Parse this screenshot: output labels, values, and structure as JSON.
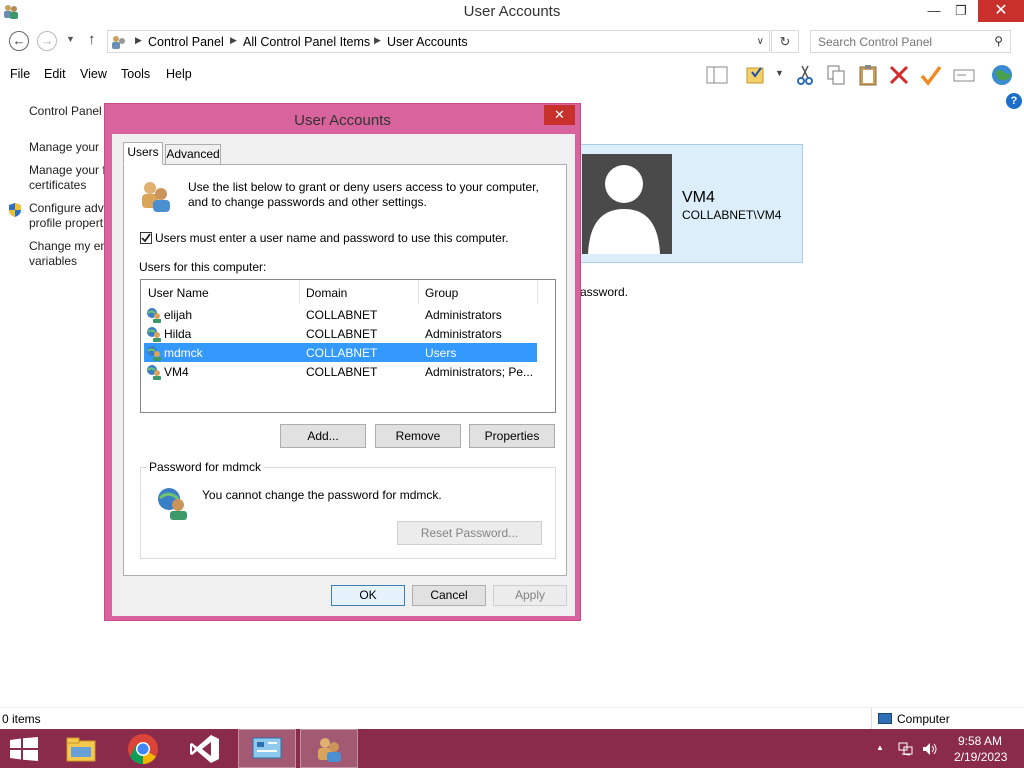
{
  "window": {
    "title": "User Accounts",
    "controls": {
      "minimize": "—",
      "maximize": "❐",
      "close": "✕"
    }
  },
  "address": {
    "crumbs": [
      "Control Panel",
      "All Control Panel Items",
      "User Accounts"
    ],
    "search_placeholder": "Search Control Panel"
  },
  "menu": [
    "File",
    "Edit",
    "View",
    "Tools",
    "Help"
  ],
  "toolbar_icons": [
    "layout-icon",
    "properties-folder-icon",
    "cut-icon",
    "copy-icon",
    "paste-icon",
    "delete-icon",
    "checkmark-icon",
    "rename-icon",
    "globe-icon"
  ],
  "left_nav": {
    "home": "Control Panel",
    "links": [
      [
        "Manage your",
        ""
      ],
      [
        "Manage your f",
        "certificates"
      ],
      [
        "Configure adv",
        "profile propert"
      ],
      [
        "Change my en",
        "variables"
      ]
    ]
  },
  "user_panel": {
    "name": "VM4",
    "domain": "COLLABNET\\VM4"
  },
  "password_hint": "assword.",
  "status": {
    "items": "0 items",
    "zone": "Computer"
  },
  "taskbar": {
    "apps": [
      "start-button",
      "file-explorer",
      "chrome",
      "visual-studio",
      "control-panel",
      "user-accounts"
    ],
    "time": "9:58 AM",
    "date": "2/19/2023",
    "tray_arrow": "▲"
  },
  "dialog": {
    "title": "User Accounts",
    "close": "✕",
    "tabs": [
      "Users",
      "Advanced"
    ],
    "intro": [
      "Use the list below to grant or deny users access to your computer,",
      "and to change passwords and other settings."
    ],
    "checkbox_label": "Users must enter a user name and password to use this computer.",
    "checkbox_checked": true,
    "list_label": "Users for this computer:",
    "columns": [
      "User Name",
      "Domain",
      "Group"
    ],
    "users": [
      {
        "name": "elijah",
        "domain": "COLLABNET",
        "group": "Administrators",
        "selected": false
      },
      {
        "name": "Hilda",
        "domain": "COLLABNET",
        "group": "Administrators",
        "selected": false
      },
      {
        "name": "mdmck",
        "domain": "COLLABNET",
        "group": "Users",
        "selected": true
      },
      {
        "name": "VM4",
        "domain": "COLLABNET",
        "group": "Administrators; Pe...",
        "selected": false
      }
    ],
    "buttons": {
      "add": "Add...",
      "remove": "Remove",
      "properties": "Properties"
    },
    "password_group_title": "Password for mdmck",
    "password_message": "You cannot change the password for mdmck.",
    "reset_password": "Reset Password...",
    "footer": {
      "ok": "OK",
      "cancel": "Cancel",
      "apply": "Apply"
    }
  }
}
